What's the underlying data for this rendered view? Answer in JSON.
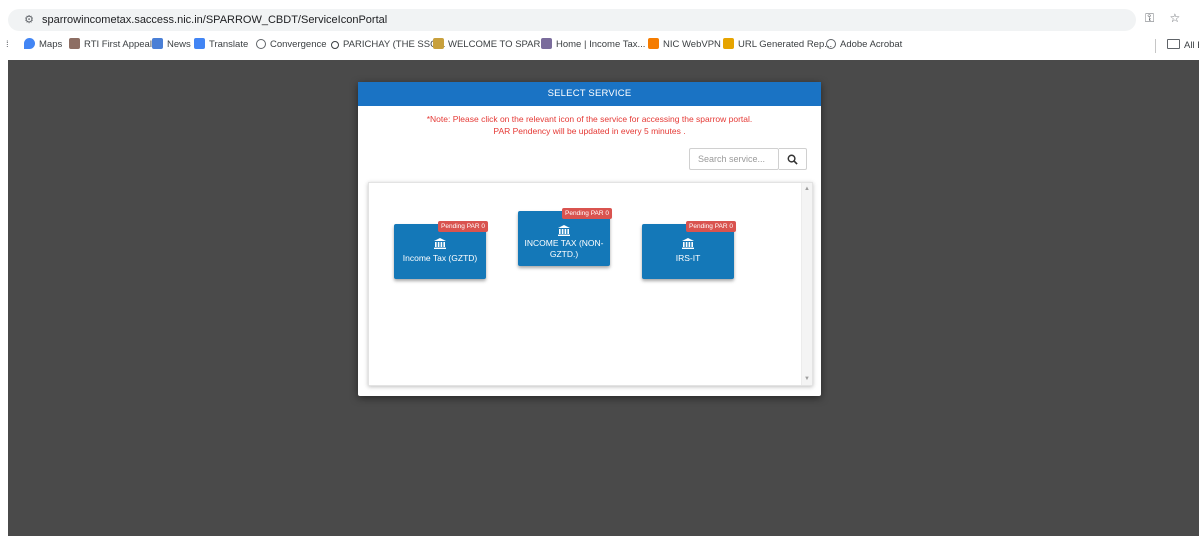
{
  "browser": {
    "url": "sparrowincometax.saccess.nic.in/SPARROW_CBDT/ServiceIconPortal",
    "bookmarks": [
      {
        "label": "Maps",
        "icon": "map-pin-icon",
        "color": "#4285f4"
      },
      {
        "label": "RTI First Appeal",
        "icon": "emblem-icon",
        "color": "#8d6e63"
      },
      {
        "label": "News",
        "icon": "news-icon",
        "color": "#4a7fd6"
      },
      {
        "label": "Translate",
        "icon": "translate-icon",
        "color": "#4285f4"
      },
      {
        "label": "Convergence",
        "icon": "globe-icon",
        "color": "#5f6368"
      },
      {
        "label": "PARICHAY (THE SSO...",
        "icon": "key-icon",
        "color": "#3c4043"
      },
      {
        "label": "WELCOME TO SPAR...",
        "icon": "sparrow-icon",
        "color": "#c8a03c"
      },
      {
        "label": "Home | Income Tax...",
        "icon": "incometax-icon",
        "color": "#7a6c9c"
      },
      {
        "label": "NIC WebVPN",
        "icon": "nic-icon",
        "color": "#f57c00"
      },
      {
        "label": "URL Generated Rep...",
        "icon": "emblem-icon",
        "color": "#e6a400"
      },
      {
        "label": "Adobe Acrobat",
        "icon": "globe-icon",
        "color": "#5f6368"
      }
    ],
    "all_bookmarks_label": "All B"
  },
  "modal": {
    "title": "SELECT SERVICE",
    "note_line1": "*Note: Please click on the relevant icon of the service for accessing the sparrow portal.",
    "note_line2": "PAR Pendency will be updated in every 5 minutes .",
    "search_placeholder": "Search service...",
    "services": [
      {
        "label": "Income Tax (GZTD)",
        "badge": "Pending PAR 0"
      },
      {
        "label": "INCOME TAX (NON-GZTD.)",
        "badge": "Pending PAR 0"
      },
      {
        "label": "IRS-IT",
        "badge": "Pending PAR 0"
      }
    ]
  },
  "colors": {
    "header_blue": "#1a73c4",
    "tile_blue": "#1478b8",
    "badge_red": "#d9534f",
    "note_red": "#e53935",
    "backdrop": "#4a4a4a"
  }
}
